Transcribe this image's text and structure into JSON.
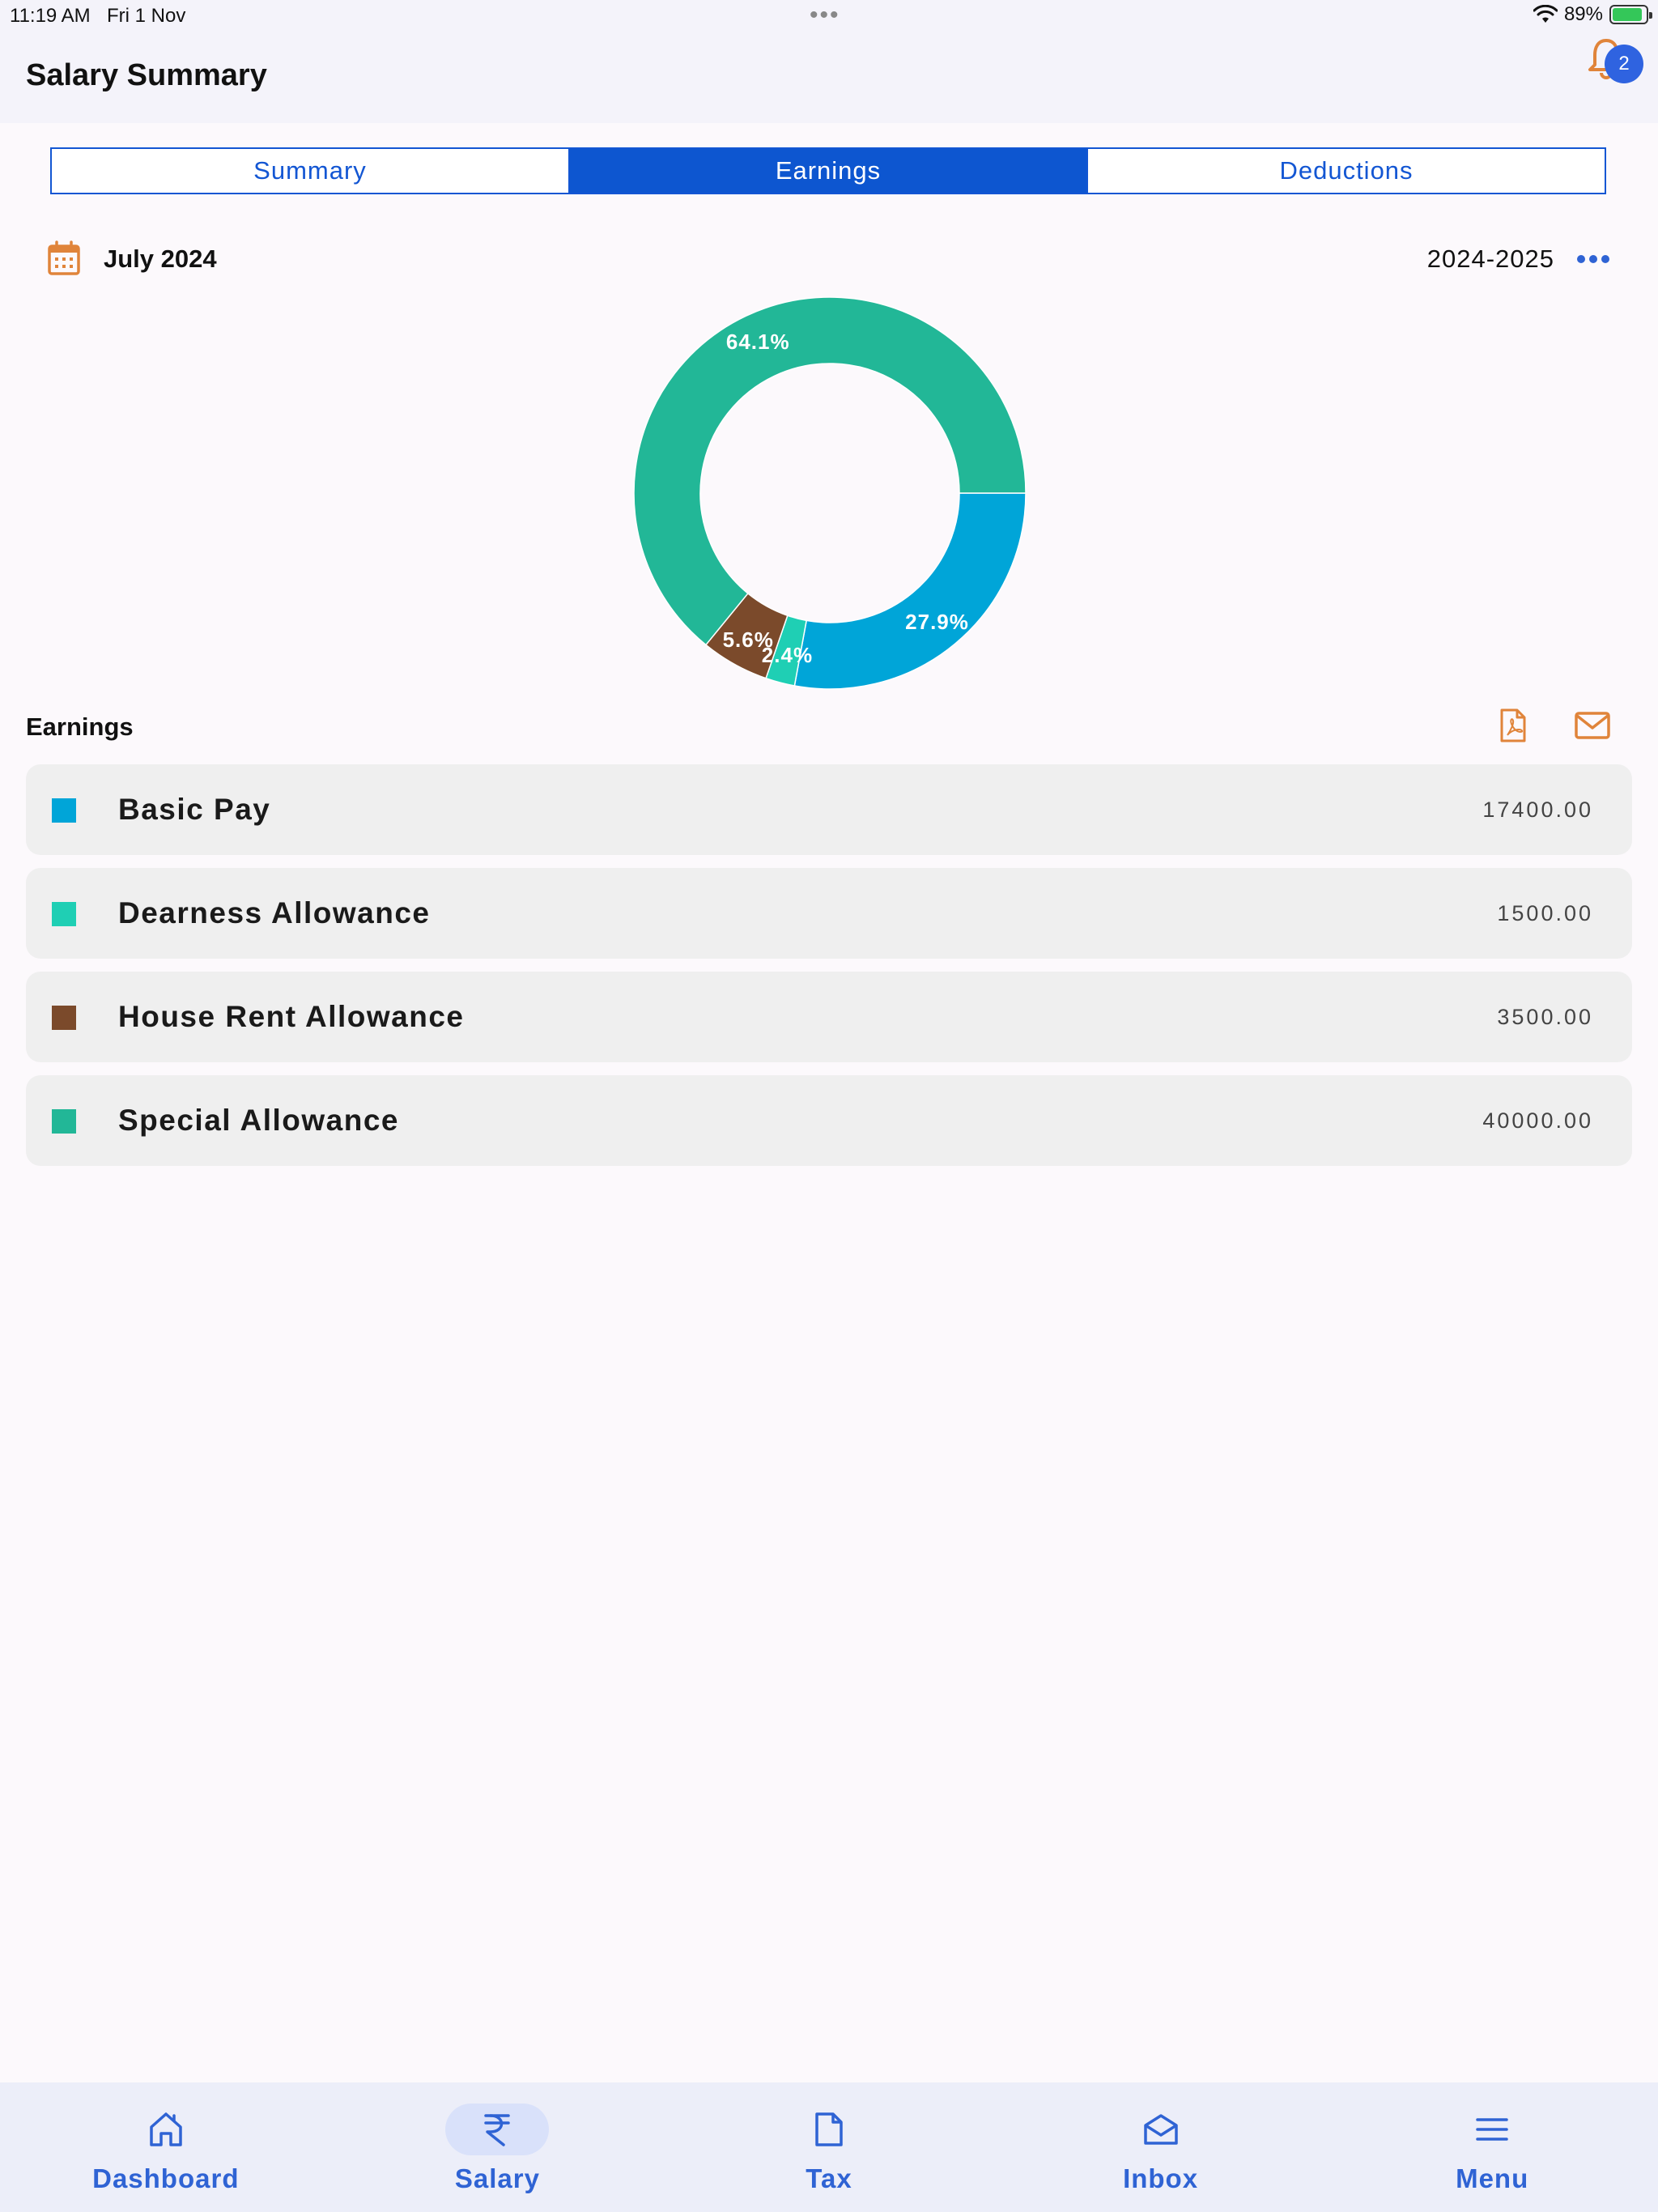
{
  "status": {
    "time": "11:19 AM",
    "date": "Fri 1 Nov",
    "battery": "89%",
    "battery_level": 0.89
  },
  "header": {
    "title": "Salary Summary",
    "notification_count": "2"
  },
  "tabs": [
    {
      "label": "Summary",
      "active": false
    },
    {
      "label": "Earnings",
      "active": true
    },
    {
      "label": "Deductions",
      "active": false
    }
  ],
  "period": {
    "month": "July 2024",
    "fiscal_year": "2024-2025"
  },
  "chart_data": {
    "type": "pie",
    "donut": true,
    "categories": [
      "Basic Pay",
      "Dearness Allowance",
      "House Rent Allowance",
      "Special Allowance"
    ],
    "values": [
      17400.0,
      1500.0,
      3500.0,
      40000.0
    ],
    "labels": [
      "27.9%",
      "2.4%",
      "5.6%",
      "64.1%"
    ],
    "colors": [
      "#00a5d8",
      "#1fcfb4",
      "#7b4a2b",
      "#22b797"
    ]
  },
  "earnings": {
    "title": "Earnings",
    "items": [
      {
        "label": "Basic Pay",
        "value": "17400.00",
        "color": "#00a5d8"
      },
      {
        "label": "Dearness Allowance",
        "value": "1500.00",
        "color": "#1fcfb4"
      },
      {
        "label": "House Rent Allowance",
        "value": "3500.00",
        "color": "#7b4a2b"
      },
      {
        "label": "Special Allowance",
        "value": "40000.00",
        "color": "#22b797"
      }
    ]
  },
  "nav": [
    {
      "label": "Dashboard",
      "icon": "home-icon",
      "active": false
    },
    {
      "label": "Salary",
      "icon": "rupee-icon",
      "active": true
    },
    {
      "label": "Tax",
      "icon": "document-icon",
      "active": false
    },
    {
      "label": "Inbox",
      "icon": "inbox-icon",
      "active": false
    },
    {
      "label": "Menu",
      "icon": "menu-icon",
      "active": false
    }
  ],
  "colors": {
    "primary": "#0d56d0",
    "accent_orange": "#e0843a",
    "nav_blue": "#2f63d4"
  }
}
